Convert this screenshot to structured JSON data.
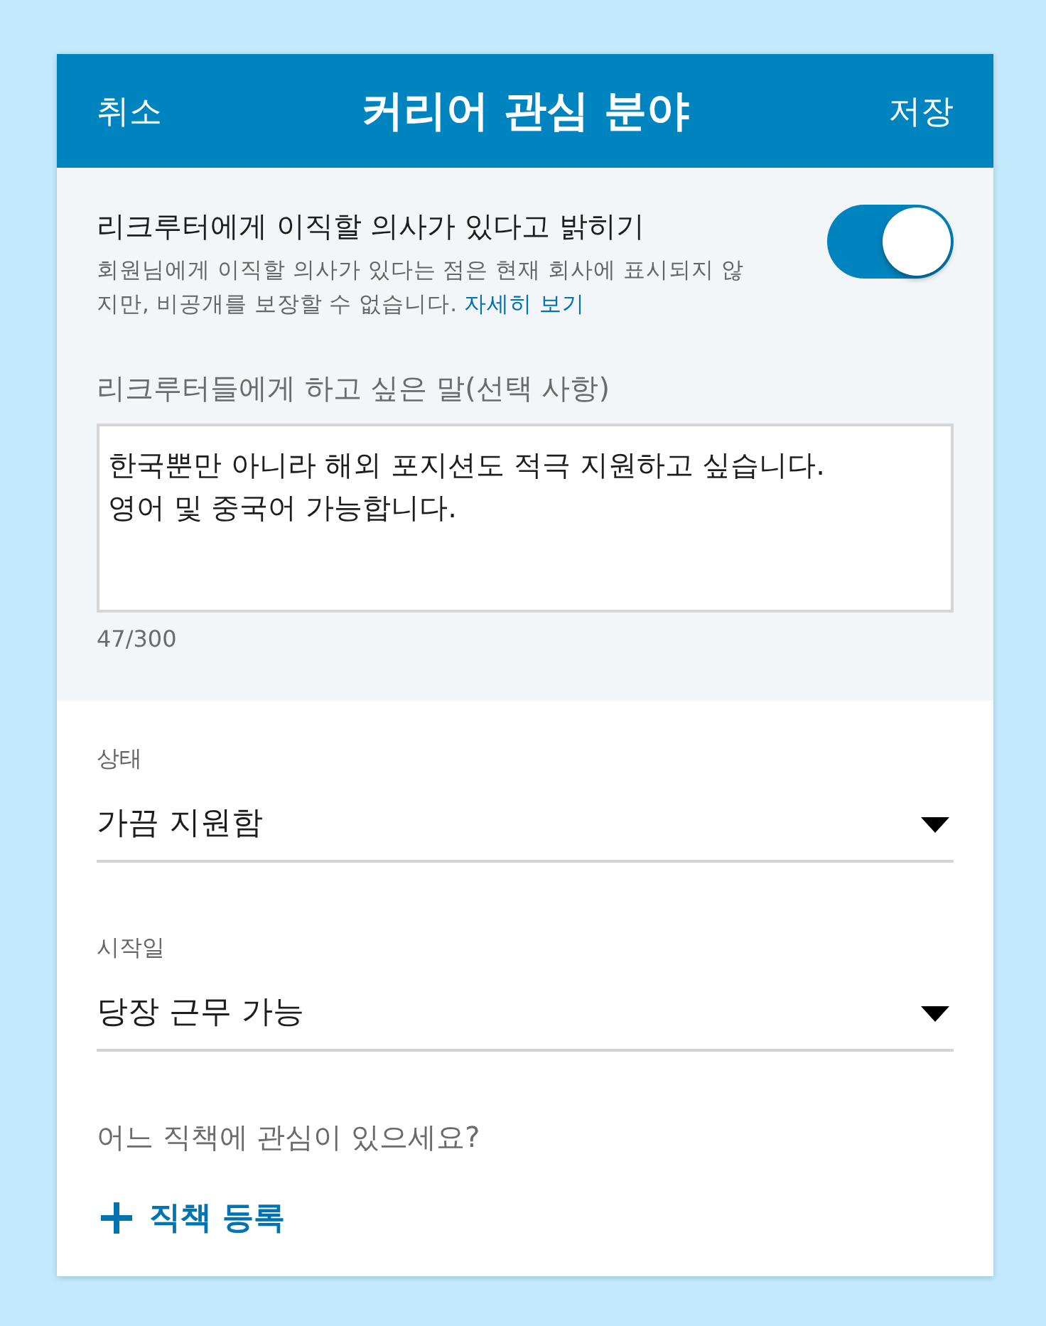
{
  "header": {
    "cancel": "취소",
    "title": "커리어 관심 분야",
    "save": "저장"
  },
  "open_to_recruiters": {
    "label": "리크루터에게 이직할 의사가 있다고 밝히기",
    "on": true,
    "description": "회원님에게 이직할 의사가 있다는 점은 현재 회사에 표시되지 않지만, 비공개를 보장할 수 없습니다.",
    "link": "자세히 보기"
  },
  "message": {
    "label": "리크루터들에게 하고 싶은 말(선택 사항)",
    "value": "한국뿐만 아니라 해외 포지션도 적극 지원하고 싶습니다.\n영어 및 중국어 가능합니다.",
    "counter": "47/300"
  },
  "selects": [
    {
      "label": "상태",
      "value": "가끔 지원함"
    },
    {
      "label": "시작일",
      "value": "당장 근무 가능"
    }
  ],
  "job_titles": {
    "question": "어느 직책에 관심이 있으세요?",
    "add_button": "직책 등록"
  }
}
